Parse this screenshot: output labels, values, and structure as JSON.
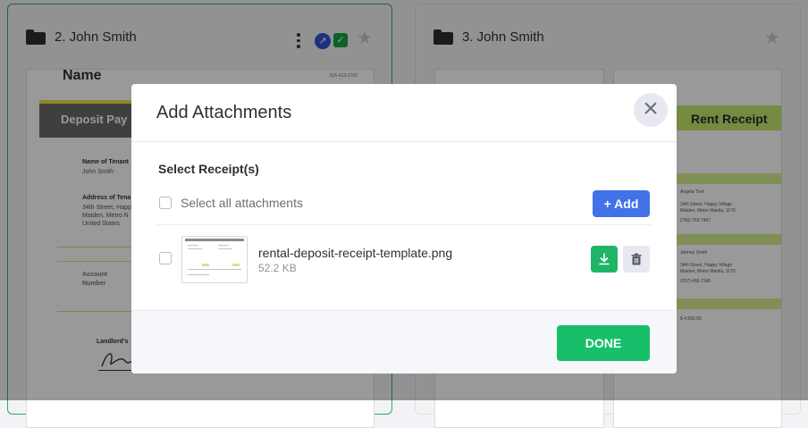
{
  "background": {
    "cards": [
      {
        "title": "2. John Smith",
        "selected": true
      },
      {
        "title": "3. John Smith",
        "selected": false
      }
    ],
    "doc1": {
      "name": "Name",
      "phone": "616-413-2789",
      "banner": "Deposit Pay",
      "tenant_label": "Name of Tenant",
      "tenant_value": "John Smith",
      "address_label": "Address of Tena",
      "address_lines": [
        "34th Street, Happ",
        "Maiden, Metro N",
        "United States"
      ],
      "account_label_1": "Account",
      "account_label_2": "Number",
      "landlord_label": "Landlord's"
    },
    "doc3": {
      "title": "Rent Receipt",
      "lines": [
        "Angela Tnet",
        "34th Street, Happy Village",
        "Maiden, Metro Manila, 1170",
        "(766) 763-7467",
        "Johnny Smith",
        "34th Street, Happy Village",
        "Maiden, Metro Manila, 1170",
        "(337) 456-7345",
        "$ 4,550.00"
      ]
    }
  },
  "modal": {
    "title": "Add Attachments",
    "section_title": "Select Receipt(s)",
    "select_all_label": "Select all attachments",
    "add_button": "+ Add",
    "attachments": [
      {
        "name": "rental-deposit-receipt-template.png",
        "size": "52.2 KB",
        "checked": false
      }
    ],
    "done_button": "DONE"
  },
  "colors": {
    "accent_green": "#18bf6a",
    "accent_blue": "#4272e8",
    "download_green": "#20b466"
  }
}
